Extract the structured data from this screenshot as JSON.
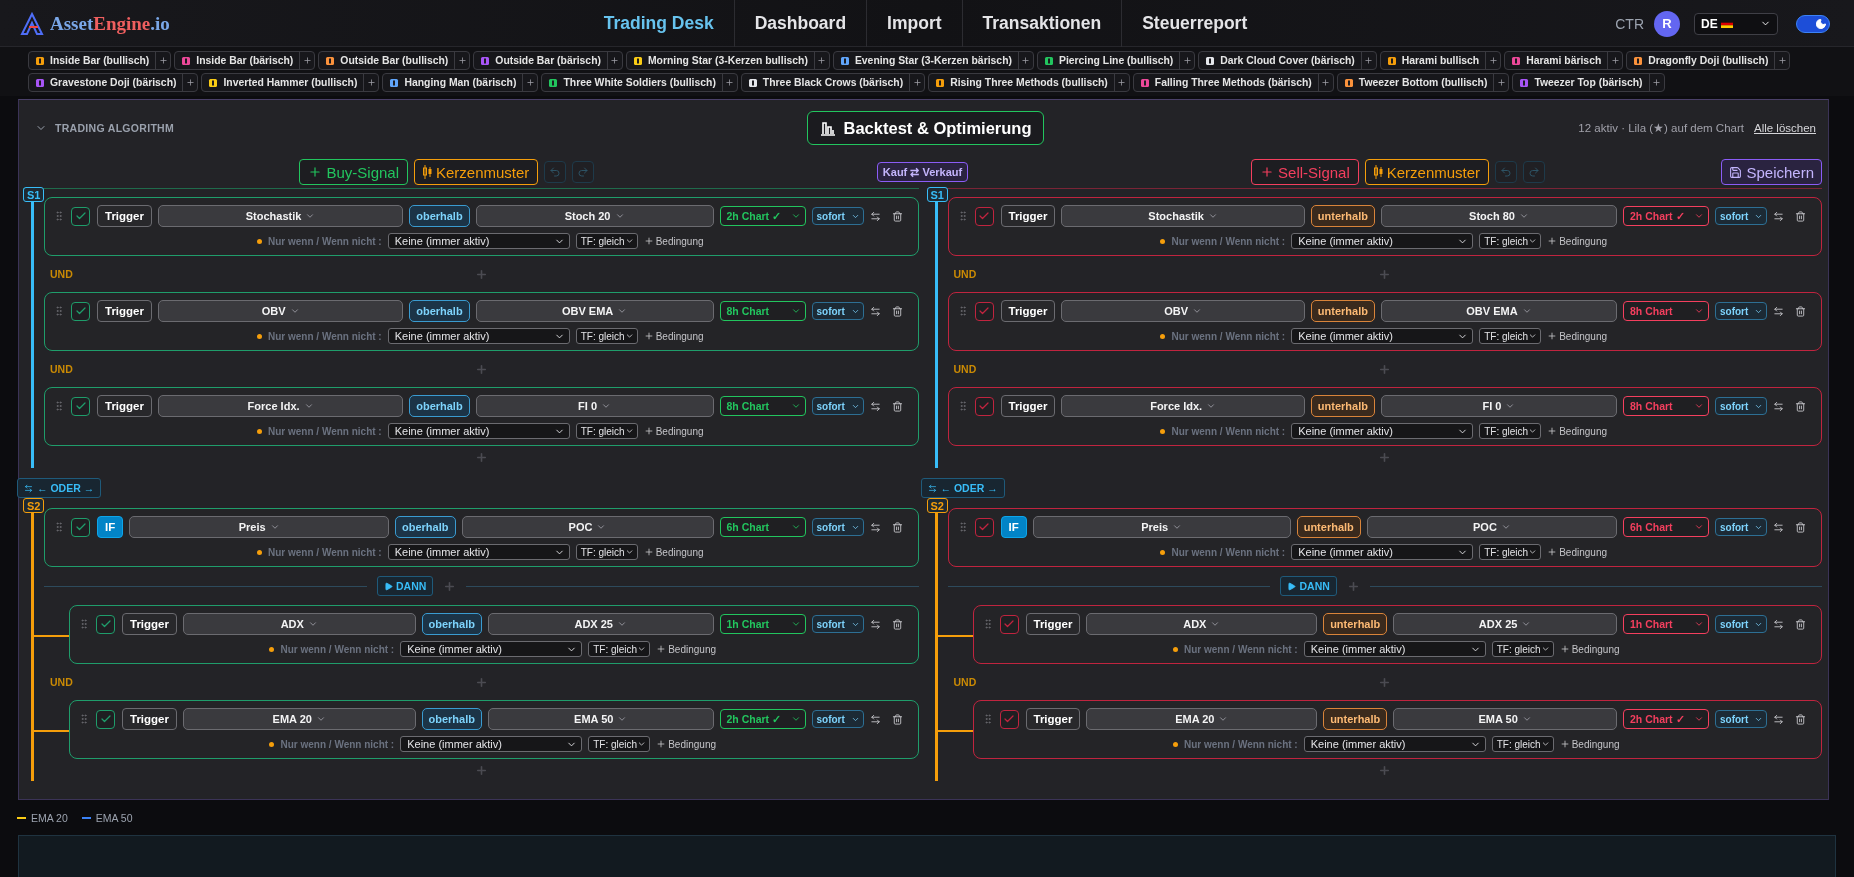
{
  "brand": {
    "parts": [
      "Asset",
      "Engine",
      ".io"
    ]
  },
  "nav": [
    {
      "label": "Trading Desk",
      "selected": true
    },
    {
      "label": "Dashboard",
      "selected": false
    },
    {
      "label": "Import",
      "selected": false
    },
    {
      "label": "Transaktionen",
      "selected": false
    },
    {
      "label": "Steuerreport",
      "selected": false
    }
  ],
  "user": {
    "currency": "CTR",
    "avatar": "R",
    "language": "DE",
    "dark_mode": true
  },
  "pattern_rows": [
    [
      "Inside Bar (bullisch)",
      "Inside Bar (bärisch)",
      "Outside Bar (bullisch)",
      "Outside Bar (bärisch)",
      "Morning Star (3-Kerzen bullisch)",
      "Evening Star (3-Kerzen bärisch)",
      "Piercing Line (bullisch)",
      "Dark Cloud Cover (bärisch)",
      "Harami bullisch",
      "Harami bärisch",
      "Dragonfly Doji (bullisch)"
    ],
    [
      "Gravestone Doji (bärisch)",
      "Inverted Hammer (bullisch)",
      "Hanging Man (bärisch)",
      "Three White Soldiers (bullisch)",
      "Three Black Crows (bärisch)",
      "Rising Three Methods (bullisch)",
      "Falling Three Methods (bärisch)",
      "Tweezer Bottom (bullisch)",
      "Tweezer Top (bärisch)"
    ]
  ],
  "algorithm": {
    "title": "TRADING ALGORITHM",
    "expanded": true,
    "backtest": "Backtest & Optimierung",
    "status": "12 aktiv · Lila (★) auf dem Chart",
    "clear": "Alle löschen",
    "swap": "Kauf ⇄ Verkauf",
    "save": "Speichern"
  },
  "columns": [
    {
      "kind": "buy",
      "signal": "Buy-Signal",
      "pattern": "Kerzenmuster",
      "strategies": [
        {
          "label": "S1",
          "color": "#38bdf8",
          "conditions": [
            {
              "checked": true,
              "kind": "trigger",
              "type": "Trigger",
              "indicator": "Stochastik",
              "relation": "oberhalb",
              "target": "Stoch 20",
              "chart": "2h Chart ✓",
              "timing": "sofort",
              "mode": "Nur wenn / Wenn nicht :",
              "filter": "Keine (immer aktiv)",
              "tf": "TF: gleich",
              "add": "Bedingung"
            },
            {
              "joiner": "UND",
              "checked": true,
              "kind": "trigger",
              "type": "Trigger",
              "indicator": "OBV",
              "relation": "oberhalb",
              "target": "OBV EMA",
              "chart": "8h Chart",
              "timing": "sofort",
              "mode": "Nur wenn / Wenn nicht :",
              "filter": "Keine (immer aktiv)",
              "tf": "TF: gleich",
              "add": "Bedingung"
            },
            {
              "joiner": "UND",
              "checked": true,
              "kind": "trigger",
              "type": "Trigger",
              "indicator": "Force Idx.",
              "relation": "oberhalb",
              "target": "FI 0",
              "chart": "8h Chart",
              "timing": "sofort",
              "mode": "Nur wenn / Wenn nicht :",
              "filter": "Keine (immer aktiv)",
              "tf": "TF: gleich",
              "add": "Bedingung"
            }
          ]
        },
        {
          "label": "S2",
          "color": "#f59e0b",
          "or_label": "← ODER →",
          "then_label": "DANN",
          "if": {
            "checked": true,
            "kind": "if",
            "type": "IF",
            "indicator": "Preis",
            "relation": "oberhalb",
            "target": "POC",
            "chart": "6h Chart",
            "timing": "sofort",
            "mode": "Nur wenn / Wenn nicht :",
            "filter": "Keine (immer aktiv)",
            "tf": "TF: gleich",
            "add": "Bedingung"
          },
          "conditions": [
            {
              "checked": true,
              "kind": "trigger",
              "type": "Trigger",
              "indicator": "ADX",
              "relation": "oberhalb",
              "target": "ADX 25",
              "chart": "1h Chart",
              "timing": "sofort",
              "mode": "Nur wenn / Wenn nicht :",
              "filter": "Keine (immer aktiv)",
              "tf": "TF: gleich",
              "add": "Bedingung"
            },
            {
              "joiner": "UND",
              "checked": true,
              "kind": "trigger",
              "type": "Trigger",
              "indicator": "EMA 20",
              "relation": "oberhalb",
              "target": "EMA 50",
              "chart": "2h Chart ✓",
              "timing": "sofort",
              "mode": "Nur wenn / Wenn nicht :",
              "filter": "Keine (immer aktiv)",
              "tf": "TF: gleich",
              "add": "Bedingung"
            }
          ]
        }
      ]
    },
    {
      "kind": "sell",
      "signal": "Sell-Signal",
      "pattern": "Kerzenmuster",
      "strategies": [
        {
          "label": "S1",
          "color": "#38bdf8",
          "conditions": [
            {
              "checked": true,
              "kind": "trigger",
              "type": "Trigger",
              "indicator": "Stochastik",
              "relation": "unterhalb",
              "target": "Stoch 80",
              "chart": "2h Chart ✓",
              "timing": "sofort",
              "mode": "Nur wenn / Wenn nicht :",
              "filter": "Keine (immer aktiv)",
              "tf": "TF: gleich",
              "add": "Bedingung"
            },
            {
              "joiner": "UND",
              "checked": true,
              "kind": "trigger",
              "type": "Trigger",
              "indicator": "OBV",
              "relation": "unterhalb",
              "target": "OBV EMA",
              "chart": "8h Chart",
              "timing": "sofort",
              "mode": "Nur wenn / Wenn nicht :",
              "filter": "Keine (immer aktiv)",
              "tf": "TF: gleich",
              "add": "Bedingung"
            },
            {
              "joiner": "UND",
              "checked": true,
              "kind": "trigger",
              "type": "Trigger",
              "indicator": "Force Idx.",
              "relation": "unterhalb",
              "target": "FI 0",
              "chart": "8h Chart",
              "timing": "sofort",
              "mode": "Nur wenn / Wenn nicht :",
              "filter": "Keine (immer aktiv)",
              "tf": "TF: gleich",
              "add": "Bedingung"
            }
          ]
        },
        {
          "label": "S2",
          "color": "#f59e0b",
          "or_label": "← ODER →",
          "then_label": "DANN",
          "if": {
            "checked": true,
            "kind": "if",
            "type": "IF",
            "indicator": "Preis",
            "relation": "unterhalb",
            "target": "POC",
            "chart": "6h Chart",
            "timing": "sofort",
            "mode": "Nur wenn / Wenn nicht :",
            "filter": "Keine (immer aktiv)",
            "tf": "TF: gleich",
            "add": "Bedingung"
          },
          "conditions": [
            {
              "checked": true,
              "kind": "trigger",
              "type": "Trigger",
              "indicator": "ADX",
              "relation": "unterhalb",
              "target": "ADX 25",
              "chart": "1h Chart",
              "timing": "sofort",
              "mode": "Nur wenn / Wenn nicht :",
              "filter": "Keine (immer aktiv)",
              "tf": "TF: gleich",
              "add": "Bedingung"
            },
            {
              "joiner": "UND",
              "checked": true,
              "kind": "trigger",
              "type": "Trigger",
              "indicator": "EMA 20",
              "relation": "unterhalb",
              "target": "EMA 50",
              "chart": "2h Chart ✓",
              "timing": "sofort",
              "mode": "Nur wenn / Wenn nicht :",
              "filter": "Keine (immer aktiv)",
              "tf": "TF: gleich",
              "add": "Bedingung"
            }
          ]
        }
      ]
    }
  ],
  "legend": [
    {
      "label": "EMA 20",
      "color": "#facc15"
    },
    {
      "label": "EMA 50",
      "color": "#3b82f6"
    }
  ]
}
